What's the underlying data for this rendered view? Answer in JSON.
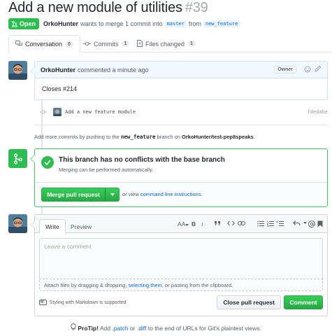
{
  "pr": {
    "title": "Add a new module of utilities",
    "number": "#39",
    "state": "Open",
    "author": "OrkoHunter",
    "meta_text": "wants to merge 1 commit into",
    "base_branch": "master",
    "from_text": "from",
    "head_branch": "new_feature"
  },
  "tabs": [
    {
      "label": "Conversation",
      "count": "0"
    },
    {
      "label": "Commits",
      "count": "1"
    },
    {
      "label": "Files changed",
      "count": "1"
    }
  ],
  "comment": {
    "author": "OrkoHunter",
    "time": "commented a minute ago",
    "badge": "Owner",
    "body": "Closes #214"
  },
  "commit": {
    "message": "Add a new feature module",
    "sha": "fdedabe"
  },
  "push_info": {
    "prefix": "Add more commits by pushing to the",
    "branch": "new_feature",
    "middle": "branch on",
    "repo": "OrkoHunter/test-pep8speaks",
    "suffix": "."
  },
  "merge": {
    "title": "This branch has no conflicts with the base branch",
    "subtitle": "Merging can be performed automatically.",
    "button": "Merge pull request",
    "alt_prefix": "or view",
    "alt_link": "command line instructions",
    "alt_suffix": "."
  },
  "editor": {
    "tab_write": "Write",
    "tab_preview": "Preview",
    "toolbar": {
      "heading": "AA",
      "bold": "B",
      "italic": "i"
    },
    "placeholder": "Leave a comment",
    "attach_prefix": "Attach files by dragging & dropping,",
    "attach_link": "selecting them",
    "attach_suffix": ", or pasting from the clipboard.",
    "markdown_note": "Styling with Markdown is supported",
    "markdown_icon": "M↓",
    "close_button": "Close pull request",
    "comment_button": "Comment"
  },
  "protip": {
    "label": "ProTip!",
    "text1": "Add",
    "ext1": ".patch",
    "text2": "or",
    "ext2": ".diff",
    "text3": "to the end of URLs for Git's plaintext views."
  },
  "colors": {
    "accent_green": "#2cbe4e",
    "link_blue": "#0366d6",
    "comment_border": "#c8e1ff"
  }
}
